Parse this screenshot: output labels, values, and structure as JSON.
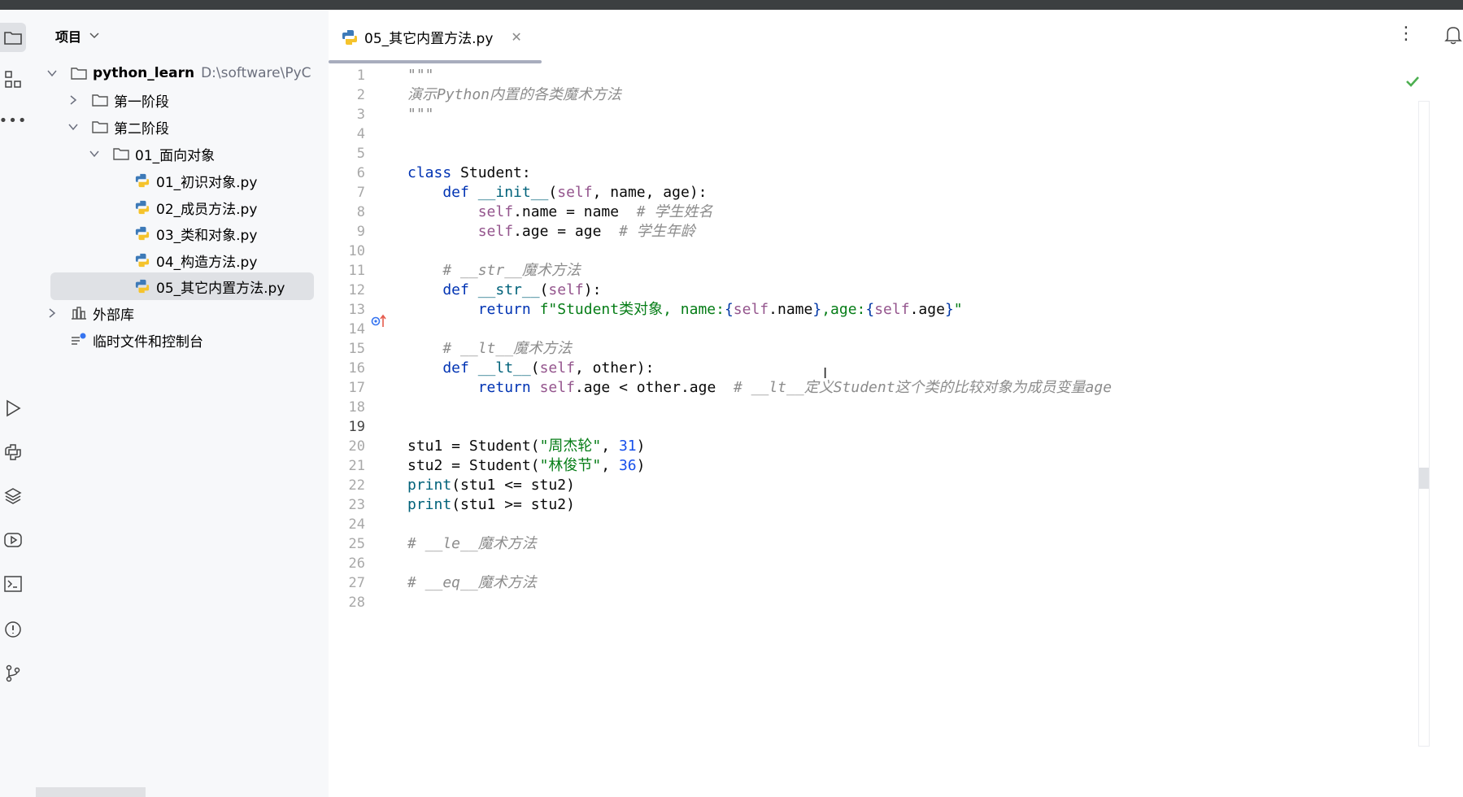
{
  "project_panel": {
    "title": "项目",
    "tree": [
      {
        "label": "python_learn",
        "path": "D:\\software\\PyC",
        "kind": "root-folder",
        "expanded": true
      },
      {
        "label": "第一阶段",
        "kind": "folder",
        "expanded": false
      },
      {
        "label": "第二阶段",
        "kind": "folder",
        "expanded": true
      },
      {
        "label": "01_面向对象",
        "kind": "folder",
        "expanded": true
      },
      {
        "label": "01_初识对象.py",
        "kind": "python-file"
      },
      {
        "label": "02_成员方法.py",
        "kind": "python-file"
      },
      {
        "label": "03_类和对象.py",
        "kind": "python-file"
      },
      {
        "label": "04_构造方法.py",
        "kind": "python-file"
      },
      {
        "label": "05_其它内置方法.py",
        "kind": "python-file",
        "selected": true
      },
      {
        "label": "外部库",
        "kind": "library",
        "expanded": false
      },
      {
        "label": "临时文件和控制台",
        "kind": "scratches"
      }
    ]
  },
  "editor": {
    "tab_label": "05_其它内置方法.py",
    "current_line": 19,
    "line_numbers": [
      "1",
      "2",
      "3",
      "4",
      "5",
      "6",
      "7",
      "8",
      "9",
      "10",
      "11",
      "12",
      "13",
      "14",
      "15",
      "16",
      "17",
      "18",
      "19",
      "20",
      "21",
      "22",
      "23",
      "24",
      "25",
      "26",
      "27",
      "28"
    ],
    "lines": [
      [
        {
          "t": "\"\"\"",
          "c": "doc"
        }
      ],
      [
        {
          "t": "演示Python内置的各类魔术方法",
          "c": "doc"
        }
      ],
      [
        {
          "t": "\"\"\"",
          "c": "doc"
        }
      ],
      [],
      [],
      [
        {
          "t": "class ",
          "c": "kw"
        },
        {
          "t": "Student:",
          "c": ""
        }
      ],
      [
        {
          "t": "    def ",
          "c": "kw"
        },
        {
          "t": "__init__",
          "c": "fn"
        },
        {
          "t": "(",
          "c": ""
        },
        {
          "t": "self",
          "c": "self"
        },
        {
          "t": ", name, age):",
          "c": ""
        }
      ],
      [
        {
          "t": "        ",
          "c": ""
        },
        {
          "t": "self",
          "c": "self"
        },
        {
          "t": ".name = name  ",
          "c": ""
        },
        {
          "t": "# 学生姓名",
          "c": "cmt"
        }
      ],
      [
        {
          "t": "        ",
          "c": ""
        },
        {
          "t": "self",
          "c": "self"
        },
        {
          "t": ".age = age  ",
          "c": ""
        },
        {
          "t": "# 学生年龄",
          "c": "cmt"
        }
      ],
      [],
      [
        {
          "t": "    ",
          "c": ""
        },
        {
          "t": "# __str__魔术方法",
          "c": "cmt"
        }
      ],
      [
        {
          "t": "    def ",
          "c": "kw"
        },
        {
          "t": "__str__",
          "c": "fn"
        },
        {
          "t": "(",
          "c": ""
        },
        {
          "t": "self",
          "c": "self"
        },
        {
          "t": "):",
          "c": ""
        }
      ],
      [
        {
          "t": "        return ",
          "c": "kw"
        },
        {
          "t": "f\"Student类对象, name:",
          "c": "str"
        },
        {
          "t": "{",
          "c": "brace"
        },
        {
          "t": "self",
          "c": "self"
        },
        {
          "t": ".name",
          "c": ""
        },
        {
          "t": "}",
          "c": "brace"
        },
        {
          "t": ",age:",
          "c": "str"
        },
        {
          "t": "{",
          "c": "brace"
        },
        {
          "t": "self",
          "c": "self"
        },
        {
          "t": ".age",
          "c": ""
        },
        {
          "t": "}",
          "c": "brace"
        },
        {
          "t": "\"",
          "c": "str"
        }
      ],
      [],
      [
        {
          "t": "    ",
          "c": ""
        },
        {
          "t": "# __lt__魔术方法",
          "c": "cmt"
        }
      ],
      [
        {
          "t": "    def ",
          "c": "kw"
        },
        {
          "t": "__lt__",
          "c": "fn"
        },
        {
          "t": "(",
          "c": ""
        },
        {
          "t": "self",
          "c": "self"
        },
        {
          "t": ", other):",
          "c": ""
        }
      ],
      [
        {
          "t": "        return ",
          "c": "kw"
        },
        {
          "t": "self",
          "c": "self"
        },
        {
          "t": ".age < other.age  ",
          "c": ""
        },
        {
          "t": "# __lt__定义Student这个类的比较对象为成员变量age",
          "c": "cmt"
        }
      ],
      [],
      [],
      [
        {
          "t": "stu1 = Student(",
          "c": ""
        },
        {
          "t": "\"周杰轮\"",
          "c": "str"
        },
        {
          "t": ", ",
          "c": ""
        },
        {
          "t": "31",
          "c": "num"
        },
        {
          "t": ")",
          "c": ""
        }
      ],
      [
        {
          "t": "stu2 = Student(",
          "c": ""
        },
        {
          "t": "\"林俊节\"",
          "c": "str"
        },
        {
          "t": ", ",
          "c": ""
        },
        {
          "t": "36",
          "c": "num"
        },
        {
          "t": ")",
          "c": ""
        }
      ],
      [
        {
          "t": "print",
          "c": "fn"
        },
        {
          "t": "(stu1 <= stu2)",
          "c": ""
        }
      ],
      [
        {
          "t": "print",
          "c": "fn"
        },
        {
          "t": "(stu1 >= stu2)",
          "c": ""
        }
      ],
      [],
      [
        {
          "t": "# __le__魔术方法",
          "c": "cmt"
        }
      ],
      [],
      [
        {
          "t": "# __eq__魔术方法",
          "c": "cmt"
        }
      ],
      []
    ]
  },
  "colors": {
    "accent": "#3574f0",
    "selection": "#dfe1e5",
    "check": "#4caf50"
  }
}
